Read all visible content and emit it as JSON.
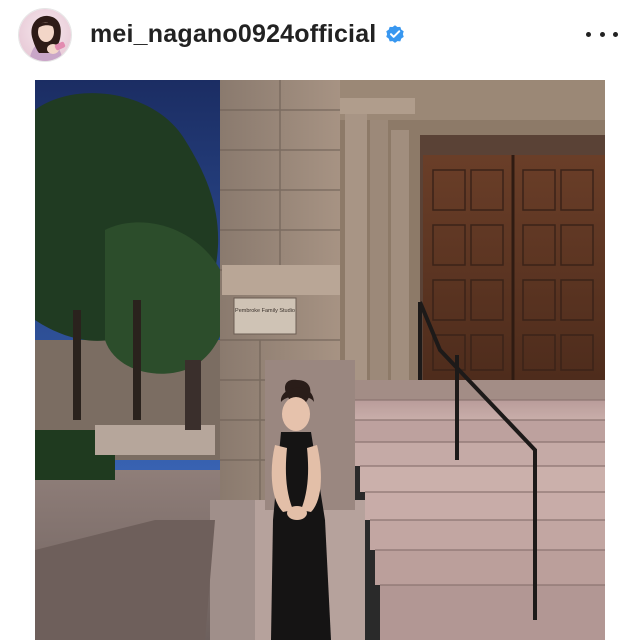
{
  "post": {
    "username": "mei_nagano0924official",
    "verified": true,
    "verified_icon": "verified-badge-icon",
    "more_icon": "more-options-icon"
  },
  "photo": {
    "plaque_text": "Pembroke Family Studio"
  },
  "colors": {
    "verified_blue": "#3897f0",
    "text": "#222222",
    "background": "#ffffff"
  }
}
